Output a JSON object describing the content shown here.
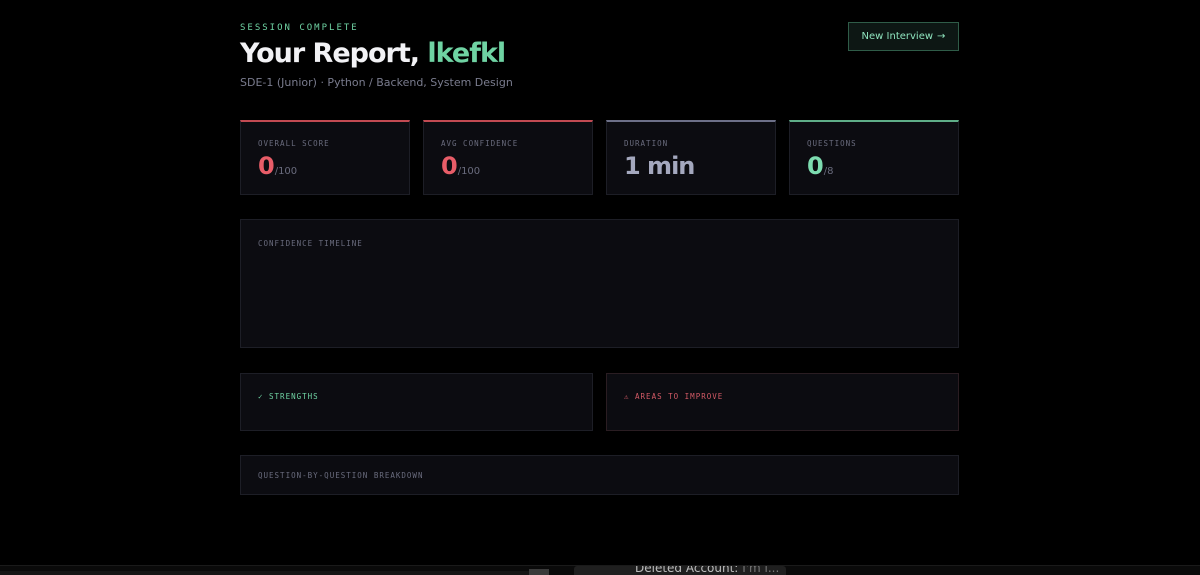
{
  "header": {
    "eyebrow": "SESSION COMPLETE",
    "title_prefix": "Your Report, ",
    "user_name": "lkefkl",
    "subtitle": "SDE-1 (Junior) · Python / Backend, System Design",
    "new_interview_label": "New Interview",
    "new_interview_arrow": "→"
  },
  "stats": [
    {
      "label": "OVERALL SCORE",
      "value": "0",
      "suffix": "/100",
      "color": "#e85d68"
    },
    {
      "label": "AVG CONFIDENCE",
      "value": "0",
      "suffix": "/100",
      "color": "#e85d68"
    },
    {
      "label": "DURATION",
      "value": "1 min",
      "suffix": "",
      "color": "#a4a8be"
    },
    {
      "label": "QUESTIONS",
      "value": "0",
      "suffix": "/8",
      "color": "#7ddcb0"
    }
  ],
  "panels": {
    "timeline_label": "CONFIDENCE TIMELINE",
    "strengths_label": "✓ STRENGTHS",
    "improve_label": "⚠ AREAS TO IMPROVE",
    "breakdown_label": "QUESTION-BY-QUESTION BREAKDOWN"
  },
  "taskbar": {
    "toast_text": "Deleted Account:",
    "toast_dim": "I'm l..."
  },
  "colors": {
    "accent_green": "#6fd3a3",
    "accent_red": "#e85d68",
    "background": "#000000",
    "card": "#0c0c11"
  }
}
